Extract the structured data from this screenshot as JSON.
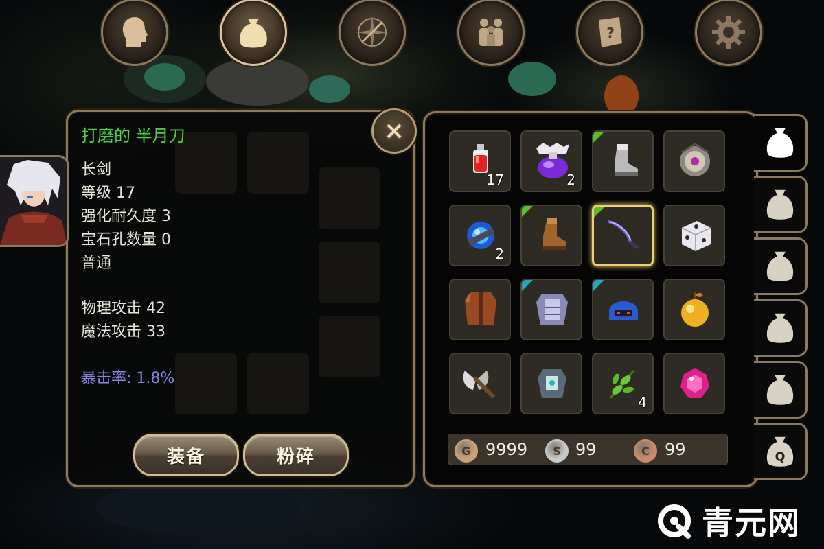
{
  "top_nav": [
    {
      "name": "character",
      "icon": "head-icon",
      "active": false
    },
    {
      "name": "inventory",
      "icon": "bag-icon",
      "active": true
    },
    {
      "name": "skills",
      "icon": "sword-compass-icon",
      "active": false
    },
    {
      "name": "party",
      "icon": "people-icon",
      "active": false
    },
    {
      "name": "quests",
      "icon": "scroll-icon",
      "active": false
    },
    {
      "name": "settings",
      "icon": "gear-icon",
      "active": false
    }
  ],
  "item_detail": {
    "name": "打磨的 半月刀",
    "type": "长剑",
    "level": "等级 17",
    "durability": "强化耐久度 3",
    "gem_slots": "宝石孔数量 0",
    "rarity": "普通",
    "physical_attack": "物理攻击 42",
    "magic_attack": "魔法攻击 33",
    "crit_rate": "暴击率: 1.8%"
  },
  "buttons": {
    "equip": "装备",
    "smash": "粉碎"
  },
  "inventory": {
    "slots": [
      {
        "icon": "red-potion-icon",
        "qty": "17",
        "corner": ""
      },
      {
        "icon": "purple-potion-icon",
        "qty": "2",
        "corner": ""
      },
      {
        "icon": "boot-icon",
        "qty": "",
        "corner": "green"
      },
      {
        "icon": "amulet-icon",
        "qty": "",
        "corner": ""
      },
      {
        "icon": "blue-gem-orb-icon",
        "qty": "2",
        "corner": ""
      },
      {
        "icon": "leather-boot-icon",
        "qty": "",
        "corner": "green"
      },
      {
        "icon": "crescent-blade-icon",
        "qty": "",
        "corner": "green",
        "selected": true
      },
      {
        "icon": "dice-icon",
        "qty": "",
        "corner": ""
      },
      {
        "icon": "leather-armor-icon",
        "qty": "",
        "corner": ""
      },
      {
        "icon": "plate-armor-icon",
        "qty": "",
        "corner": "teal"
      },
      {
        "icon": "blue-helmet-icon",
        "qty": "",
        "corner": "teal"
      },
      {
        "icon": "golden-apple-icon",
        "qty": "",
        "corner": ""
      },
      {
        "icon": "battle-axe-icon",
        "qty": "",
        "corner": ""
      },
      {
        "icon": "chest-armor-icon",
        "qty": "",
        "corner": ""
      },
      {
        "icon": "herb-leaf-icon",
        "qty": "4",
        "corner": ""
      },
      {
        "icon": "pink-gem-icon",
        "qty": "",
        "corner": ""
      }
    ]
  },
  "currency": {
    "gold": {
      "letter": "G",
      "value": "9999",
      "color": "#c9a27a"
    },
    "silver": {
      "letter": "S",
      "value": "99",
      "color": "#c8c8c8"
    },
    "copper": {
      "letter": "C",
      "value": "99",
      "color": "#c98a6a"
    }
  },
  "side_tabs": [
    {
      "icon": "bag-icon",
      "active": true,
      "label": ""
    },
    {
      "icon": "bag-icon",
      "active": false,
      "label": ""
    },
    {
      "icon": "bag-icon",
      "active": false,
      "label": ""
    },
    {
      "icon": "bag-icon",
      "active": false,
      "label": ""
    },
    {
      "icon": "bag-icon",
      "active": false,
      "label": ""
    },
    {
      "icon": "quest-bag-icon",
      "active": false,
      "label": "Q"
    }
  ],
  "watermark": {
    "text": "青元网"
  }
}
